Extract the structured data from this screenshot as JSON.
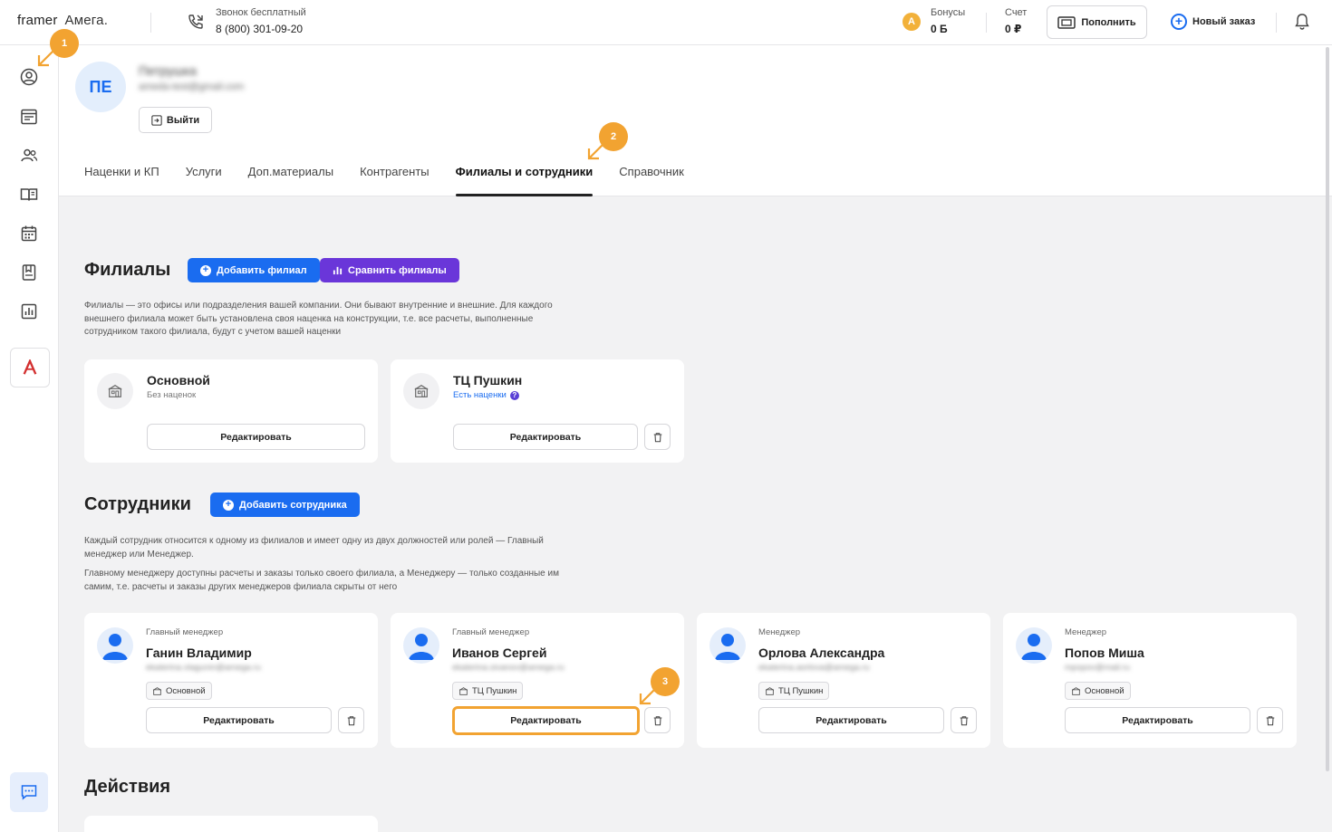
{
  "header": {
    "logo_framer": "framer",
    "logo_amega": "Амега.",
    "phone_label": "Звонок бесплатный",
    "phone_number": "8 (800) 301-09-20",
    "bonus_label": "Бонусы",
    "bonus_value": "0 Б",
    "bonus_icon_letter": "A",
    "account_label": "Счет",
    "account_value": "0 ₽",
    "topup_label": "Пополнить",
    "new_order_label": "Новый заказ"
  },
  "sidebar": {
    "items": [
      "profile-icon",
      "orders-icon",
      "clients-icon",
      "catalog-icon",
      "calendar-icon",
      "bookmark-icon",
      "stats-icon"
    ],
    "brand_letter": "A"
  },
  "profile": {
    "initials": "ПЕ",
    "name": "Петрушка",
    "email": "ameda-test@gmail.com",
    "logout_label": "Выйти"
  },
  "tabs": [
    {
      "label": "Наценки и КП",
      "active": false
    },
    {
      "label": "Услуги",
      "active": false
    },
    {
      "label": "Доп.материалы",
      "active": false
    },
    {
      "label": "Контрагенты",
      "active": false
    },
    {
      "label": "Филиалы и сотрудники",
      "active": true
    },
    {
      "label": "Справочник",
      "active": false
    }
  ],
  "branches": {
    "title": "Филиалы",
    "add_label": "Добавить филиал",
    "compare_label": "Сравнить филиалы",
    "description_lines": [
      "Филиалы — это офисы или подразделения вашей компании. Они бывают внутренние и внешние. Для каждого",
      "внешнего филиала может быть установлена своя наценка на конструкции, т.е. все расчеты, выполненные",
      "сотрудником такого филиала, будут с учетом вашей наценки"
    ],
    "cards": [
      {
        "name": "Основной",
        "sub": "Без наценок",
        "edit_label": "Редактировать"
      },
      {
        "name": "ТЦ Пушкин",
        "sub": "Есть наценки",
        "edit_label": "Редактировать"
      }
    ]
  },
  "employees": {
    "title": "Сотрудники",
    "add_label": "Добавить сотрудника",
    "description_lines_1": [
      "Каждый сотрудник относится к одному из филиалов и имеет одну из двух должностей или ролей — Главный",
      "менеджер или Менеджер."
    ],
    "description_lines_2": [
      "Главному менеджеру доступны расчеты и заказы только своего филиала, а Менеджеру — только созданные им",
      "самим, т.е. расчеты и заказы других менеджеров филиала скрыты от него"
    ],
    "cards": [
      {
        "role": "Главный менеджер",
        "name": "Ганин Владимир",
        "email": "ekaterina.vlagunin@amega.ru",
        "branch": "Основной",
        "edit_label": "Редактировать"
      },
      {
        "role": "Главный менеджер",
        "name": "Иванов Сергей",
        "email": "ekaterina.sivanov@amega.ru",
        "branch": "ТЦ Пушкин",
        "edit_label": "Редактировать"
      },
      {
        "role": "Менеджер",
        "name": "Орлова Александра",
        "email": "ekaterina.aorlova@amega.ru",
        "branch": "ТЦ Пушкин",
        "edit_label": "Редактировать"
      },
      {
        "role": "Менеджер",
        "name": "Попов Миша",
        "email": "mpopov@mail.ru",
        "branch": "Основной",
        "edit_label": "Редактировать"
      }
    ]
  },
  "actions": {
    "title": "Действия"
  },
  "annotations": {
    "step1": "1",
    "step2": "2",
    "step3": "3",
    "color": "#f2a331"
  }
}
